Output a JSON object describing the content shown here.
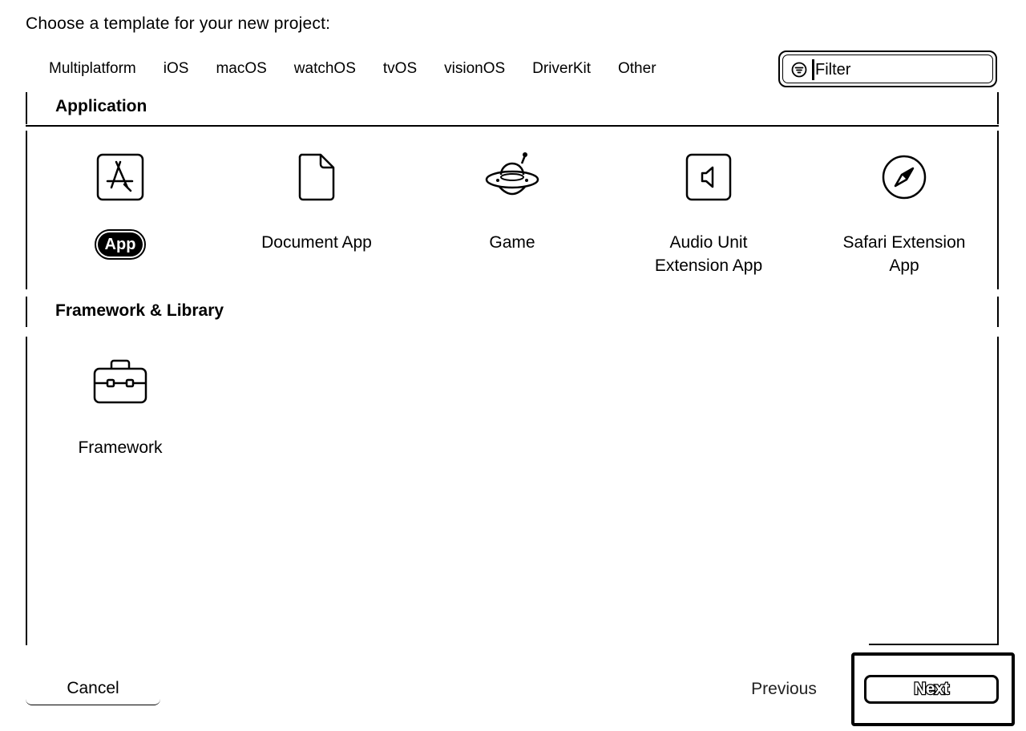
{
  "dialog": {
    "title": "Choose a template for your new project:"
  },
  "platforms": [
    {
      "label": "Multiplatform"
    },
    {
      "label": "iOS"
    },
    {
      "label": "macOS"
    },
    {
      "label": "watchOS"
    },
    {
      "label": "tvOS"
    },
    {
      "label": "visionOS"
    },
    {
      "label": "DriverKit"
    },
    {
      "label": "Other"
    }
  ],
  "filter": {
    "placeholder": "Filter",
    "icon": "filter-circle-icon"
  },
  "sections": [
    {
      "title": "Application",
      "templates": [
        {
          "label": "App",
          "icon": "app-store-icon",
          "selected": true
        },
        {
          "label": "Document App",
          "icon": "document-icon"
        },
        {
          "label": "Game",
          "icon": "gamecontroller-ufo-icon"
        },
        {
          "label_line1": "Audio Unit",
          "label_line2": "Extension App",
          "icon": "audio-unit-icon"
        },
        {
          "label_line1": "Safari Extension",
          "label_line2": "App",
          "icon": "safari-compass-icon"
        }
      ]
    },
    {
      "title": "Framework & Library",
      "templates": [
        {
          "label": "Framework",
          "icon": "toolbox-icon"
        }
      ]
    }
  ],
  "footer": {
    "cancel_label": "Cancel",
    "previous_label": "Previous",
    "next_label": "Next"
  }
}
